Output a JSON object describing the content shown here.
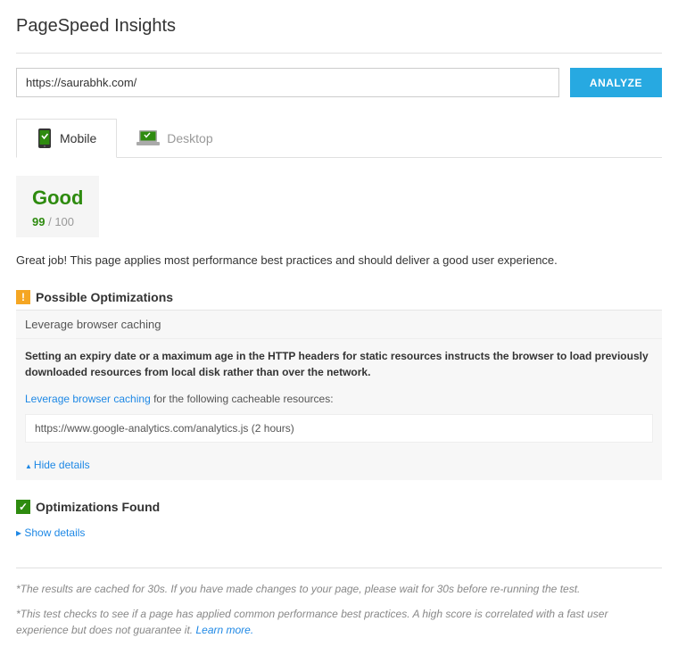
{
  "header": {
    "title": "PageSpeed Insights"
  },
  "urlbar": {
    "value": "https://saurabhk.com/",
    "analyze_label": "ANALYZE"
  },
  "tabs": {
    "mobile": "Mobile",
    "desktop": "Desktop"
  },
  "score": {
    "label": "Good",
    "value": "99",
    "separator": " / ",
    "total": "100"
  },
  "summary": "Great job! This page applies most performance best practices and should deliver a good user experience.",
  "possible": {
    "badge": "!",
    "title": "Possible Optimizations",
    "subheading": "Leverage browser caching",
    "description": "Setting an expiry date or a maximum age in the HTTP headers for static resources instructs the browser to load previously downloaded resources from local disk rather than over the network.",
    "link_text": "Leverage browser caching",
    "link_after": " for the following cacheable resources:",
    "resource": "https://www.google-analytics.com/analytics.js (2 hours)",
    "hide": "Hide details"
  },
  "found": {
    "badge": "✓",
    "title": "Optimizations Found",
    "show": "Show details"
  },
  "footer": {
    "note1": "*The results are cached for 30s. If you have made changes to your page, please wait for 30s before re-running the test.",
    "note2_a": "*This test checks to see if a page has applied common performance best practices. A high score is correlated with a fast user experience but does not guarantee it. ",
    "learn_more": "Learn more."
  }
}
